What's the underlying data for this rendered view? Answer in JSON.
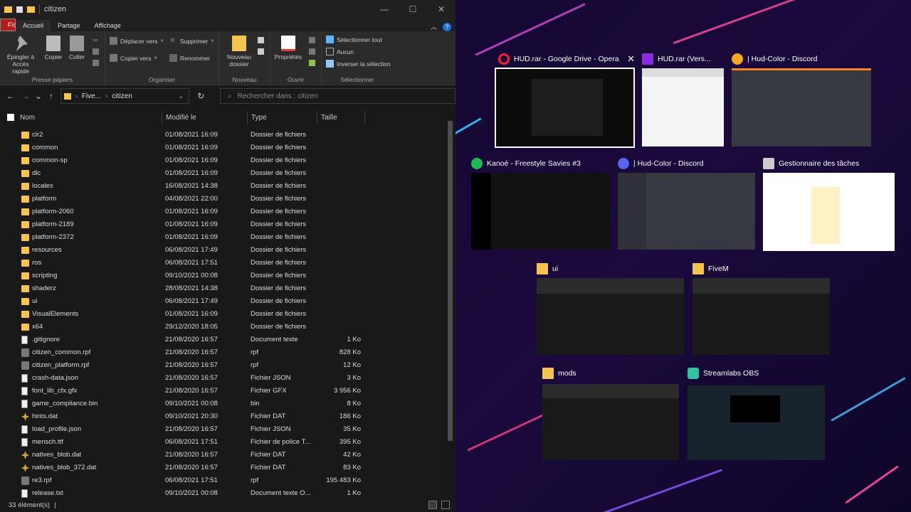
{
  "explorer": {
    "title": "citizen",
    "tabs": {
      "file": "Fichier",
      "home": "Accueil",
      "share": "Partage",
      "view": "Affichage"
    },
    "ribbon": {
      "pin": "Épingler à\nAccès rapide",
      "copy": "Copier",
      "paste": "Coller",
      "clipboard": "Presse-papiers",
      "move": "Déplacer vers",
      "copyto": "Copier vers",
      "delete": "Supprimer",
      "rename": "Renommer",
      "organize": "Organiser",
      "newfolder": "Nouveau\ndossier",
      "new": "Nouveau",
      "properties": "Propriétés",
      "open": "Ouvrir",
      "selectall": "Sélectionner tout",
      "selectnone": "Aucun",
      "invert": "Inverser la sélection",
      "select": "Sélectionner"
    },
    "address": {
      "path1": "Five...",
      "path2": "citizen",
      "search_placeholder": "Rechercher dans : citizen"
    },
    "columns": {
      "name": "Nom",
      "modified": "Modifié le",
      "type": "Type",
      "size": "Taille"
    },
    "files": [
      {
        "name": "clr2",
        "date": "01/08/2021 16:09",
        "type": "Dossier de fichiers",
        "size": "",
        "icon": "folder"
      },
      {
        "name": "common",
        "date": "01/08/2021 16:09",
        "type": "Dossier de fichiers",
        "size": "",
        "icon": "folder"
      },
      {
        "name": "common-sp",
        "date": "01/08/2021 16:09",
        "type": "Dossier de fichiers",
        "size": "",
        "icon": "folder"
      },
      {
        "name": "dlc",
        "date": "01/08/2021 16:09",
        "type": "Dossier de fichiers",
        "size": "",
        "icon": "folder"
      },
      {
        "name": "locales",
        "date": "16/08/2021 14:38",
        "type": "Dossier de fichiers",
        "size": "",
        "icon": "folder"
      },
      {
        "name": "platform",
        "date": "04/08/2021 22:00",
        "type": "Dossier de fichiers",
        "size": "",
        "icon": "folder"
      },
      {
        "name": "platform-2060",
        "date": "01/08/2021 16:09",
        "type": "Dossier de fichiers",
        "size": "",
        "icon": "folder"
      },
      {
        "name": "platform-2189",
        "date": "01/08/2021 16:09",
        "type": "Dossier de fichiers",
        "size": "",
        "icon": "folder"
      },
      {
        "name": "platform-2372",
        "date": "01/08/2021 16:09",
        "type": "Dossier de fichiers",
        "size": "",
        "icon": "folder"
      },
      {
        "name": "resources",
        "date": "06/08/2021 17:49",
        "type": "Dossier de fichiers",
        "size": "",
        "icon": "folder"
      },
      {
        "name": "ros",
        "date": "06/08/2021 17:51",
        "type": "Dossier de fichiers",
        "size": "",
        "icon": "folder"
      },
      {
        "name": "scripting",
        "date": "09/10/2021 00:08",
        "type": "Dossier de fichiers",
        "size": "",
        "icon": "folder"
      },
      {
        "name": "shaderz",
        "date": "28/08/2021 14:38",
        "type": "Dossier de fichiers",
        "size": "",
        "icon": "folder"
      },
      {
        "name": "ui",
        "date": "06/08/2021 17:49",
        "type": "Dossier de fichiers",
        "size": "",
        "icon": "folder"
      },
      {
        "name": "VisualElements",
        "date": "01/08/2021 16:09",
        "type": "Dossier de fichiers",
        "size": "",
        "icon": "folder"
      },
      {
        "name": "x64",
        "date": "29/12/2020 18:05",
        "type": "Dossier de fichiers",
        "size": "",
        "icon": "folder"
      },
      {
        "name": ".gitignore",
        "date": "21/08/2020 16:57",
        "type": "Document texte",
        "size": "1 Ko",
        "icon": "file"
      },
      {
        "name": "citizen_common.rpf",
        "date": "21/08/2020 16:57",
        "type": "rpf",
        "size": "828 Ko",
        "icon": "rpf"
      },
      {
        "name": "citizen_platform.rpf",
        "date": "21/08/2020 16:57",
        "type": "rpf",
        "size": "12 Ko",
        "icon": "rpf"
      },
      {
        "name": "crash-data.json",
        "date": "21/08/2020 16:57",
        "type": "Fichier JSON",
        "size": "3 Ko",
        "icon": "file"
      },
      {
        "name": "font_lib_cfx.gfx",
        "date": "21/08/2020 16:57",
        "type": "Fichier GFX",
        "size": "3 956 Ko",
        "icon": "file"
      },
      {
        "name": "game_compliance.bin",
        "date": "09/10/2021 00:08",
        "type": "bin",
        "size": "8 Ko",
        "icon": "file"
      },
      {
        "name": "hints.dat",
        "date": "09/10/2021 20:30",
        "type": "Fichier DAT",
        "size": "186 Ko",
        "icon": "dat"
      },
      {
        "name": "load_profile.json",
        "date": "21/08/2020 16:57",
        "type": "Fichier JSON",
        "size": "35 Ko",
        "icon": "file"
      },
      {
        "name": "mensch.ttf",
        "date": "06/08/2021 17:51",
        "type": "Fichier de police T...",
        "size": "395 Ko",
        "icon": "file"
      },
      {
        "name": "natives_blob.dat",
        "date": "21/08/2020 16:57",
        "type": "Fichier DAT",
        "size": "42 Ko",
        "icon": "dat"
      },
      {
        "name": "natives_blob_372.dat",
        "date": "21/08/2020 16:57",
        "type": "Fichier DAT",
        "size": "83 Ko",
        "icon": "dat"
      },
      {
        "name": "re3.rpf",
        "date": "06/08/2021 17:51",
        "type": "rpf",
        "size": "195 483 Ko",
        "icon": "rpf"
      },
      {
        "name": "release.txt",
        "date": "09/10/2021 00:08",
        "type": "Document texte O...",
        "size": "1 Ko",
        "icon": "file"
      }
    ],
    "status": "33 élément(s)"
  },
  "taskview": {
    "windows": [
      {
        "title": "HUD.rar - Google Drive - Opera",
        "icon": "opera-icon",
        "color": "#ff1b2d",
        "close": "✕"
      },
      {
        "title": "HUD.rar (Vers...",
        "icon": "winrar-icon",
        "color": "#8a2be2"
      },
      {
        "title": "| Hud-Color - Discord",
        "icon": "discord-icon",
        "color": "#f5a623"
      },
      {
        "title": "Kanoé - Freestyle Savies #3",
        "icon": "spotify-icon",
        "color": "#1db954"
      },
      {
        "title": "| Hud-Color - Discord",
        "icon": "discord-icon",
        "color": "#5865f2"
      },
      {
        "title": "Gestionnaire des tâches",
        "icon": "task-manager-icon",
        "color": "#cccccc"
      },
      {
        "title": "ui",
        "icon": "folder-icon",
        "color": "#f3c44f"
      },
      {
        "title": "FiveM",
        "icon": "folder-icon",
        "color": "#f3c44f"
      },
      {
        "title": "mods",
        "icon": "folder-icon",
        "color": "#f3c44f"
      },
      {
        "title": "Streamlabs OBS",
        "icon": "streamlabs-icon",
        "color": "#31c3a2"
      }
    ]
  }
}
